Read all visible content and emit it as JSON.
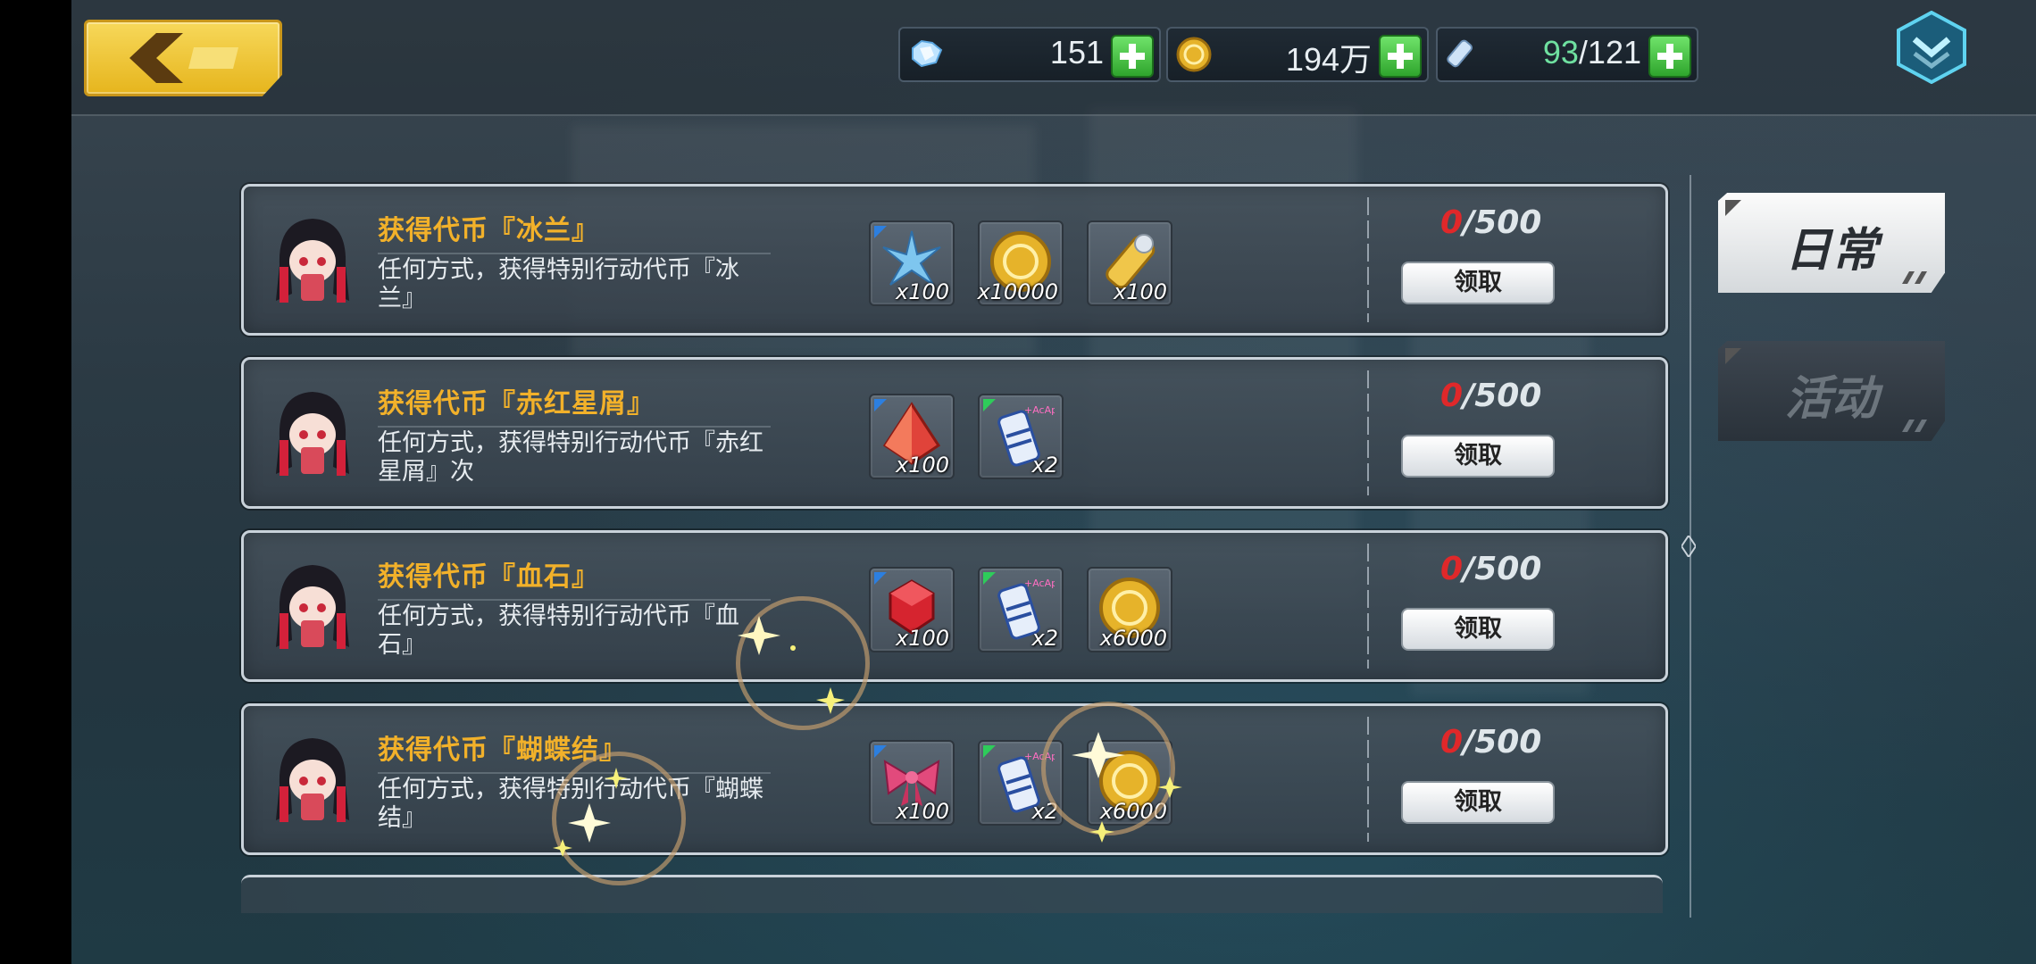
{
  "topbar": {
    "resources": [
      {
        "icon": "crystal-icon",
        "value": "151"
      },
      {
        "icon": "gold-coin-icon",
        "value": "194万"
      },
      {
        "icon": "stamina-icon",
        "value_current": "93",
        "value_max": "/121"
      }
    ]
  },
  "tasks": [
    {
      "title": "获得代币『冰兰』",
      "desc": "任何方式，获得特别行动代币『冰兰』",
      "rewards": [
        {
          "icon": "ice-crystal-icon",
          "qty": "x100",
          "corner": "blue"
        },
        {
          "icon": "gold-coin-icon",
          "qty": "x10000",
          "corner": "none"
        },
        {
          "icon": "stamina-potion-icon",
          "qty": "x100",
          "corner": "none"
        }
      ],
      "progress_current": "0",
      "progress_total": "/500",
      "claim_label": "领取"
    },
    {
      "title": "获得代币『赤红星屑』",
      "desc": "任何方式，获得特别行动代币『赤红星屑』次",
      "rewards": [
        {
          "icon": "red-crystal-icon",
          "qty": "x100",
          "corner": "blue"
        },
        {
          "icon": "acap-drink-icon",
          "qty": "x2",
          "corner": "green"
        }
      ],
      "progress_current": "0",
      "progress_total": "/500",
      "claim_label": "领取"
    },
    {
      "title": "获得代币『血石』",
      "desc": "任何方式，获得特别行动代币『血石』",
      "rewards": [
        {
          "icon": "blood-stone-icon",
          "qty": "x100",
          "corner": "blue"
        },
        {
          "icon": "acap-drink-icon",
          "qty": "x2",
          "corner": "green"
        },
        {
          "icon": "gold-coin-icon",
          "qty": "x6000",
          "corner": "none"
        }
      ],
      "progress_current": "0",
      "progress_total": "/500",
      "claim_label": "领取"
    },
    {
      "title": "获得代币『蝴蝶结』",
      "desc": "任何方式，获得特别行动代币『蝴蝶结』",
      "rewards": [
        {
          "icon": "bow-ribbon-icon",
          "qty": "x100",
          "corner": "blue"
        },
        {
          "icon": "acap-drink-icon",
          "qty": "x2",
          "corner": "green"
        },
        {
          "icon": "gold-coin-icon",
          "qty": "x6000",
          "corner": "none"
        }
      ],
      "progress_current": "0",
      "progress_total": "/500",
      "claim_label": "领取"
    }
  ],
  "tabs": {
    "daily": "日常",
    "event": "活动"
  },
  "acap_label": "+AcAp"
}
